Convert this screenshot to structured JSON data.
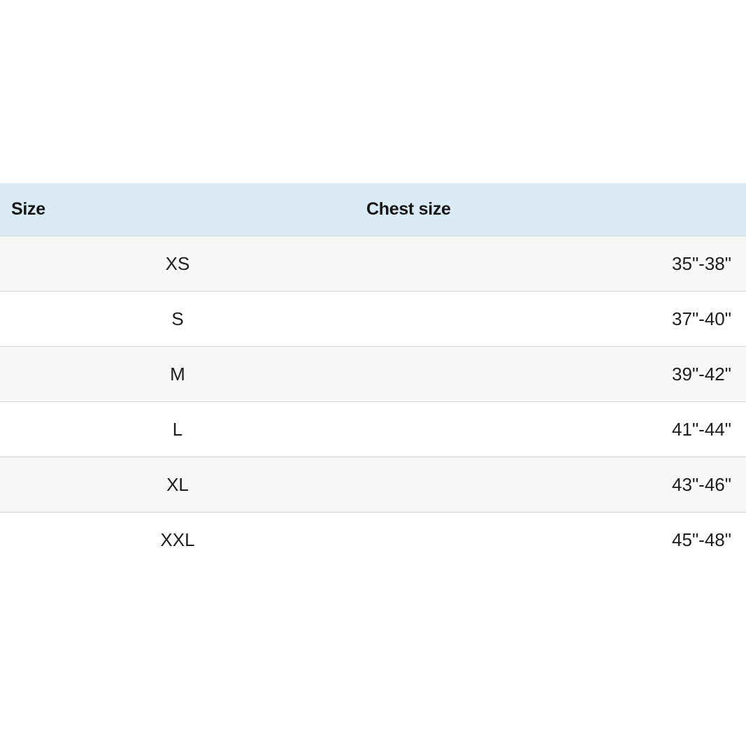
{
  "table": {
    "headers": {
      "size": "Size",
      "chest": "Chest size"
    },
    "rows": [
      {
        "size": "XS",
        "chest": "35\"-38\""
      },
      {
        "size": "S",
        "chest": "37\"-40\""
      },
      {
        "size": "M",
        "chest": "39\"-42\""
      },
      {
        "size": "L",
        "chest": "41\"-44\""
      },
      {
        "size": "XL",
        "chest": "43\"-46\""
      },
      {
        "size": "XXL",
        "chest": "45\"-48\""
      }
    ]
  },
  "colors": {
    "header_background": "#dbebf6",
    "alt_row_background": "#f7f7f7",
    "divider": "#d2d2d2"
  }
}
